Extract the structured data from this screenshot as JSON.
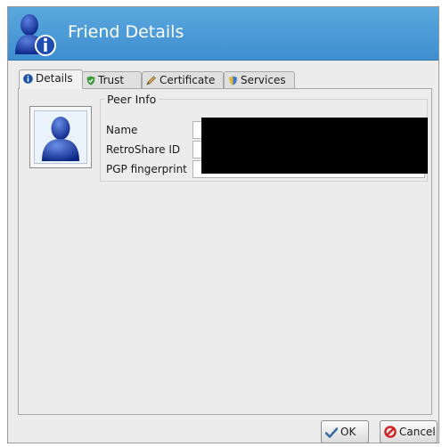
{
  "window": {
    "title": "Friend Details"
  },
  "tabs": [
    {
      "label": "Details",
      "icon": "info-icon",
      "active": true
    },
    {
      "label": "Trust",
      "icon": "shield-icon",
      "active": false
    },
    {
      "label": "Certificate",
      "icon": "pen-icon",
      "active": false
    },
    {
      "label": "Services",
      "icon": "services-icon",
      "active": false
    }
  ],
  "peer_info": {
    "title": "Peer Info",
    "fields": [
      {
        "label": "Name",
        "value": ""
      },
      {
        "label": "RetroShare ID",
        "value": ""
      },
      {
        "label": "PGP fingerprint",
        "value": ""
      }
    ]
  },
  "buttons": {
    "ok": "OK",
    "cancel": "Cancel"
  },
  "colors": {
    "header": "#4a9ad6",
    "ok_check": "#3a6ea5",
    "cancel_red": "#d22020"
  }
}
